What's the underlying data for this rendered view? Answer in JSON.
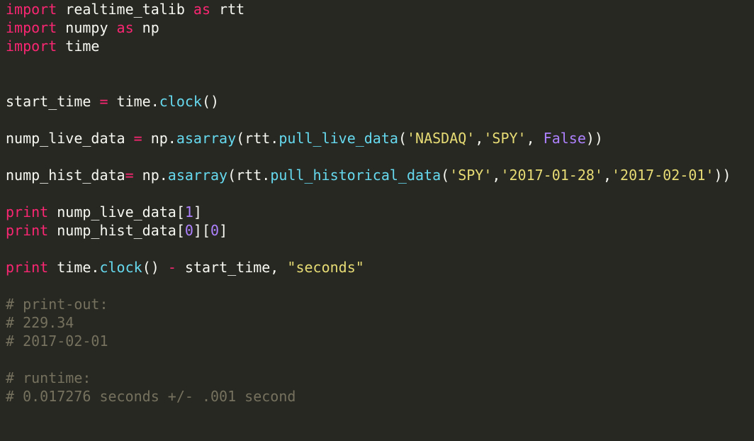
{
  "editor": {
    "background": "#272822",
    "colors": {
      "keyword": "#f92672",
      "function": "#66d9ef",
      "string": "#e6db74",
      "number": "#ae81ff",
      "comment": "#75715e",
      "text": "#f8f8f2"
    },
    "lines": [
      [
        {
          "t": "import",
          "c": "kw"
        },
        {
          "t": " realtime_talib ",
          "c": "id"
        },
        {
          "t": "as",
          "c": "kw"
        },
        {
          "t": " rtt",
          "c": "id"
        }
      ],
      [
        {
          "t": "import",
          "c": "kw"
        },
        {
          "t": " numpy ",
          "c": "id"
        },
        {
          "t": "as",
          "c": "kw"
        },
        {
          "t": " np",
          "c": "id"
        }
      ],
      [
        {
          "t": "import",
          "c": "kw"
        },
        {
          "t": " time",
          "c": "id"
        }
      ],
      [],
      [],
      [
        {
          "t": "start_time ",
          "c": "id"
        },
        {
          "t": "=",
          "c": "op"
        },
        {
          "t": " time.",
          "c": "id"
        },
        {
          "t": "clock",
          "c": "fn"
        },
        {
          "t": "()",
          "c": "id"
        }
      ],
      [],
      [
        {
          "t": "nump_live_data ",
          "c": "id"
        },
        {
          "t": "=",
          "c": "op"
        },
        {
          "t": " np.",
          "c": "id"
        },
        {
          "t": "asarray",
          "c": "fn"
        },
        {
          "t": "(rtt.",
          "c": "id"
        },
        {
          "t": "pull_live_data",
          "c": "fn"
        },
        {
          "t": "(",
          "c": "id"
        },
        {
          "t": "'NASDAQ'",
          "c": "str"
        },
        {
          "t": ",",
          "c": "id"
        },
        {
          "t": "'SPY'",
          "c": "str"
        },
        {
          "t": ", ",
          "c": "id"
        },
        {
          "t": "False",
          "c": "const"
        },
        {
          "t": "))",
          "c": "id"
        }
      ],
      [],
      [
        {
          "t": "nump_hist_data",
          "c": "id"
        },
        {
          "t": "=",
          "c": "op"
        },
        {
          "t": " np.",
          "c": "id"
        },
        {
          "t": "asarray",
          "c": "fn"
        },
        {
          "t": "(rtt.",
          "c": "id"
        },
        {
          "t": "pull_historical_data",
          "c": "fn"
        },
        {
          "t": "(",
          "c": "id"
        },
        {
          "t": "'SPY'",
          "c": "str"
        },
        {
          "t": ",",
          "c": "id"
        },
        {
          "t": "'2017-01-28'",
          "c": "str"
        },
        {
          "t": ",",
          "c": "id"
        },
        {
          "t": "'2017-02-01'",
          "c": "str"
        },
        {
          "t": "))",
          "c": "id"
        }
      ],
      [],
      [
        {
          "t": "print",
          "c": "kw"
        },
        {
          "t": " nump_live_data[",
          "c": "id"
        },
        {
          "t": "1",
          "c": "num"
        },
        {
          "t": "]",
          "c": "id"
        }
      ],
      [
        {
          "t": "print",
          "c": "kw"
        },
        {
          "t": " nump_hist_data[",
          "c": "id"
        },
        {
          "t": "0",
          "c": "num"
        },
        {
          "t": "][",
          "c": "id"
        },
        {
          "t": "0",
          "c": "num"
        },
        {
          "t": "]",
          "c": "id"
        }
      ],
      [],
      [
        {
          "t": "print",
          "c": "kw"
        },
        {
          "t": " time.",
          "c": "id"
        },
        {
          "t": "clock",
          "c": "fn"
        },
        {
          "t": "() ",
          "c": "id"
        },
        {
          "t": "-",
          "c": "op"
        },
        {
          "t": " start_time, ",
          "c": "id"
        },
        {
          "t": "\"seconds\"",
          "c": "str"
        }
      ],
      [],
      [
        {
          "t": "# print-out:",
          "c": "cmt"
        }
      ],
      [
        {
          "t": "# 229.34",
          "c": "cmt"
        }
      ],
      [
        {
          "t": "# 2017-02-01",
          "c": "cmt"
        }
      ],
      [],
      [
        {
          "t": "# runtime:",
          "c": "cmt"
        }
      ],
      [
        {
          "t": "# 0.017276 seconds +/- .001 second",
          "c": "cmt"
        }
      ]
    ]
  }
}
